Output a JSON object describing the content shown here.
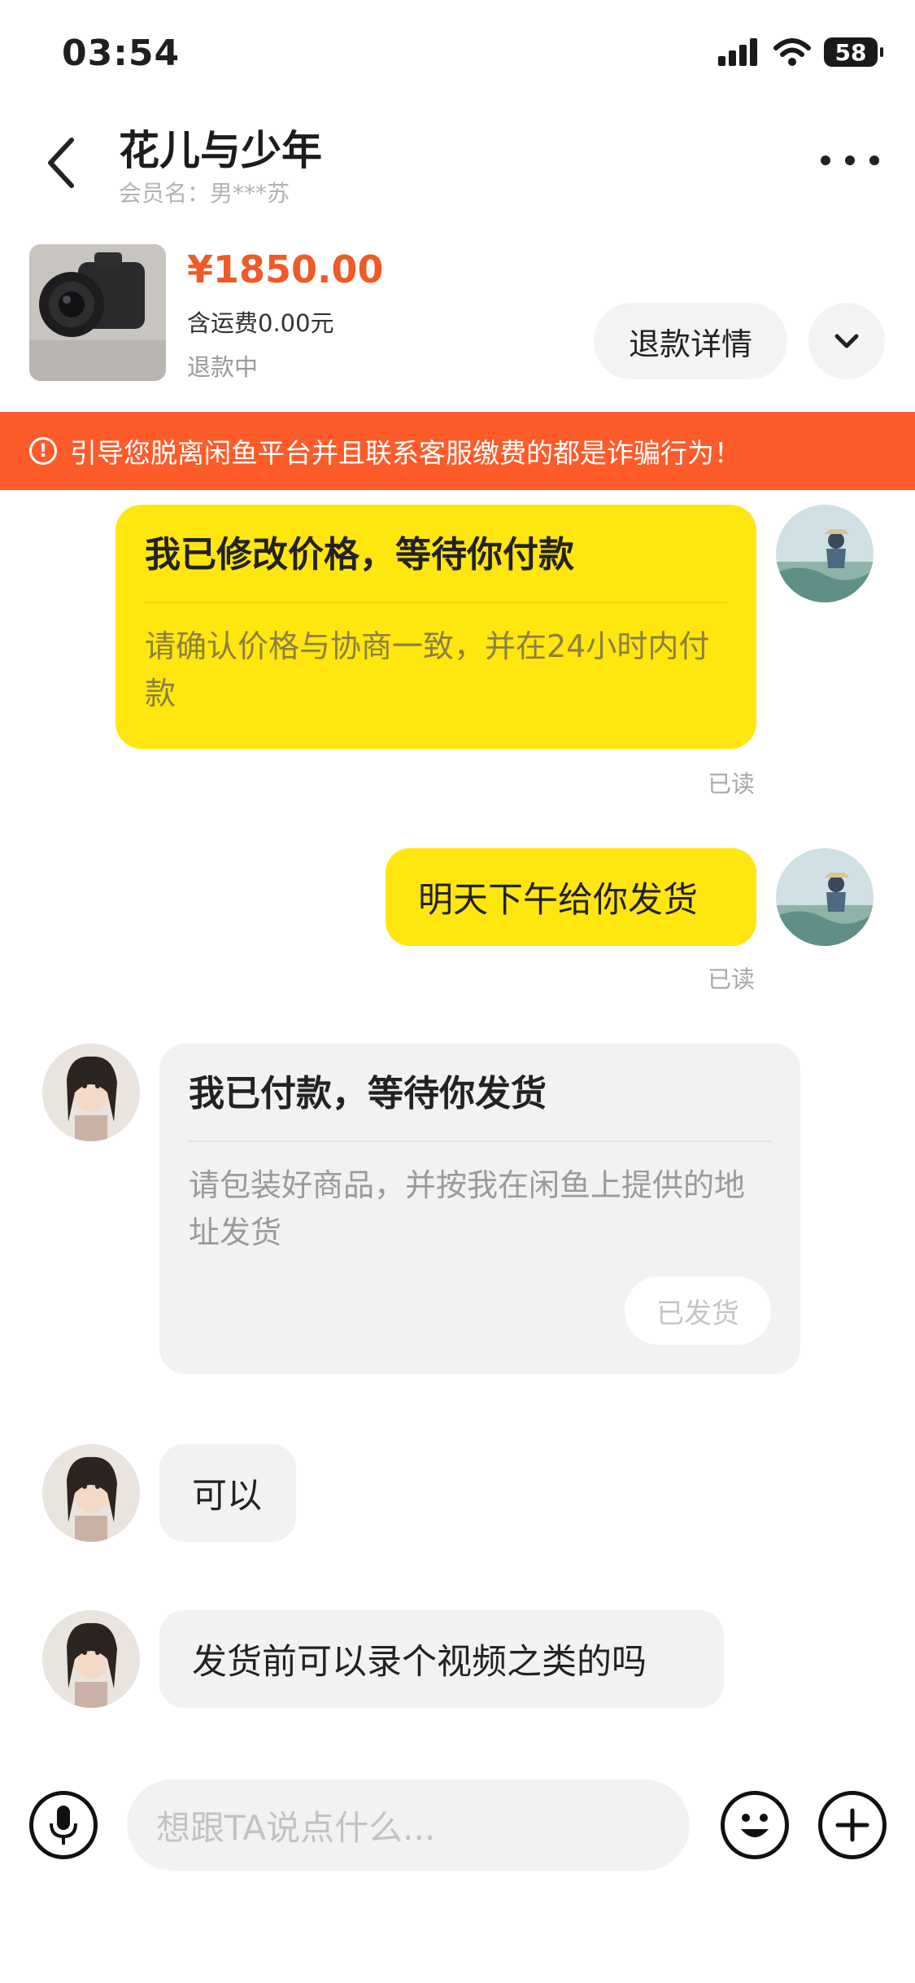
{
  "status_bar": {
    "time": "03:54",
    "battery": "58"
  },
  "header": {
    "title": "花儿与少年",
    "member": "会员名：男***苏"
  },
  "product": {
    "price": "¥1850.00",
    "shipping": "含运费0.00元",
    "status": "退款中",
    "refund_button": "退款详情"
  },
  "warning": {
    "text": "引导您脱离闲鱼平台并且联系客服缴费的都是诈骗行为！"
  },
  "messages": [
    {
      "title": "我已修改价格，等待你付款",
      "body": "请确认价格与协商一致，并在24小时内付款",
      "read": "已读"
    },
    {
      "text": "明天下午给你发货",
      "read": "已读"
    },
    {
      "title": "我已付款，等待你发货",
      "body": "请包装好商品，并按我在闲鱼上提供的地址发货",
      "button": "已发货"
    },
    {
      "text": "可以"
    },
    {
      "text": "发货前可以录个视频之类的吗"
    }
  ],
  "input": {
    "placeholder": "想跟TA说点什么..."
  },
  "colors": {
    "accent_yellow": "#ffe60f",
    "warning_orange": "#fe5b2b",
    "price_orange": "#ef5a28"
  },
  "icons": [
    "back-icon",
    "more-icon",
    "chevron-down-icon",
    "warning-icon",
    "mic-icon",
    "emoji-icon",
    "plus-icon",
    "wifi-icon",
    "signal-icon"
  ]
}
